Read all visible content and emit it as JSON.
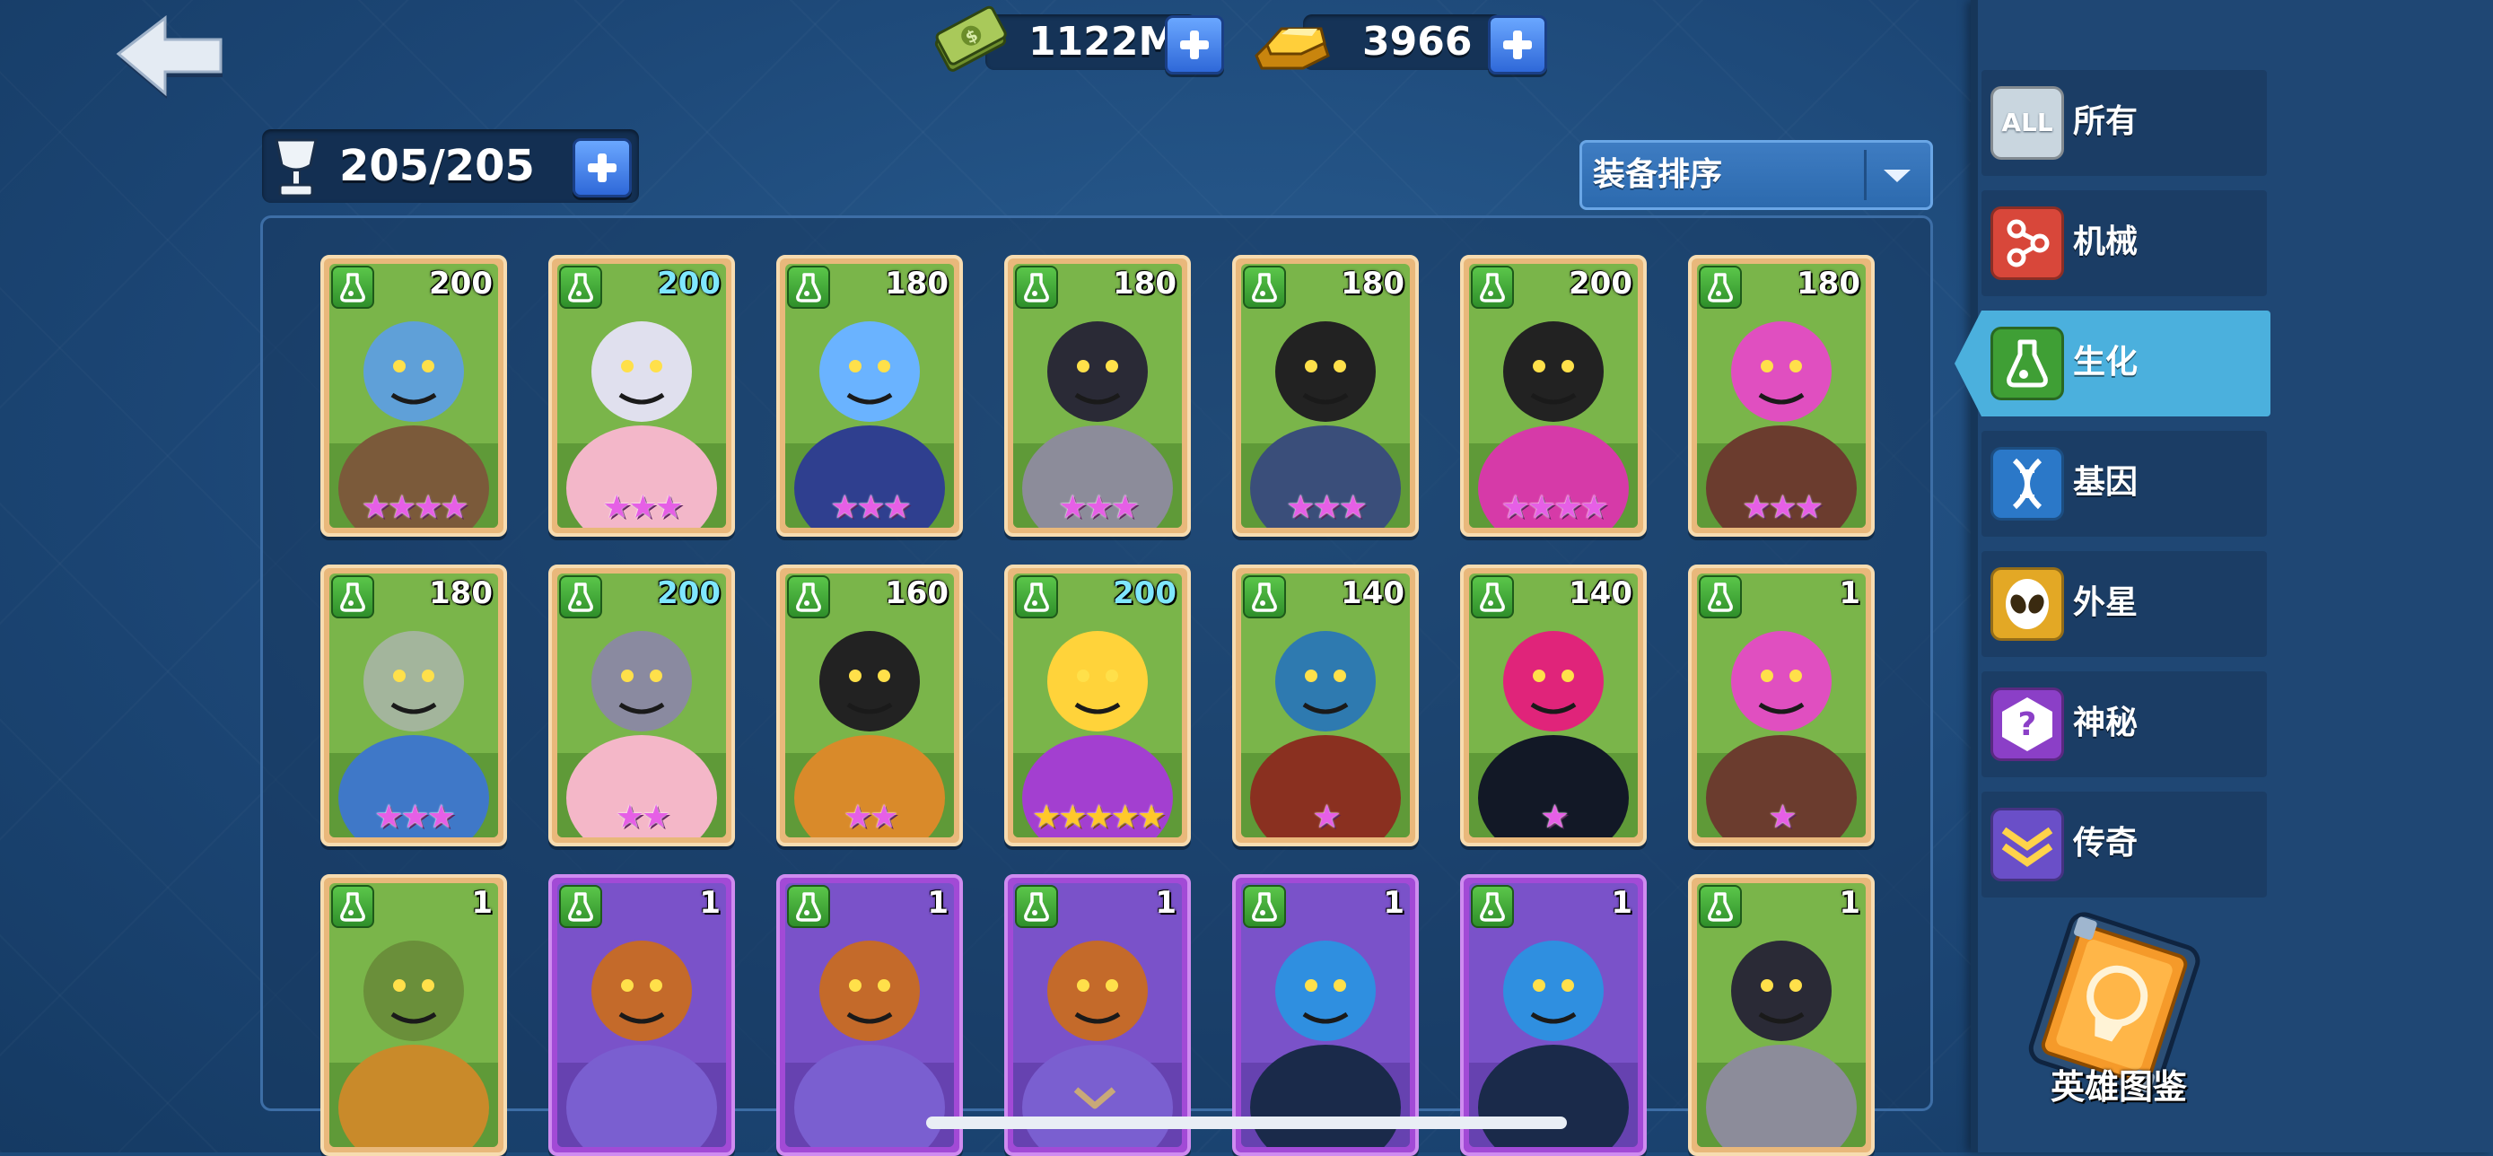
{
  "currency": {
    "cash": {
      "value": "1122M",
      "icon": "cash-icon"
    },
    "gold": {
      "value": "3966",
      "icon": "gold-bar-icon"
    }
  },
  "roster": {
    "count": "205/205",
    "icon": "trophy-cup-icon"
  },
  "sort": {
    "label": "装备排序"
  },
  "sidebar": {
    "items": [
      {
        "label": "所有",
        "icon": "all-icon",
        "icon_text": "ALL",
        "color": "#c9d6df",
        "active": false
      },
      {
        "label": "机械",
        "icon": "mechanical-icon",
        "color": "#d8473a",
        "active": false
      },
      {
        "label": "生化",
        "icon": "biochemical-flask-icon",
        "color": "#3f9f35",
        "active": true
      },
      {
        "label": "基因",
        "icon": "gene-dna-icon",
        "color": "#2b78c8",
        "active": false
      },
      {
        "label": "外星",
        "icon": "alien-icon",
        "color": "#e3a825",
        "active": false
      },
      {
        "label": "神秘",
        "icon": "mystic-question-icon",
        "color": "#8b3fc7",
        "active": false
      },
      {
        "label": "传奇",
        "icon": "legendary-chevron-icon",
        "color": "#6a4fc8",
        "active": false
      }
    ],
    "codex_label": "英雄图鉴"
  },
  "heroes": [
    {
      "level": "200",
      "stars": "★★★★",
      "frame": "orange",
      "level_color": "white",
      "star_color": "pink"
    },
    {
      "level": "200",
      "stars": "★★★",
      "frame": "orange",
      "level_color": "cyan",
      "star_color": "pink"
    },
    {
      "level": "180",
      "stars": "★★★",
      "frame": "orange",
      "level_color": "white",
      "star_color": "pink"
    },
    {
      "level": "180",
      "stars": "★★★",
      "frame": "orange",
      "level_color": "white",
      "star_color": "pink"
    },
    {
      "level": "180",
      "stars": "★★★",
      "frame": "orange",
      "level_color": "white",
      "star_color": "pink"
    },
    {
      "level": "200",
      "stars": "★★★★",
      "frame": "orange",
      "level_color": "white",
      "star_color": "pink"
    },
    {
      "level": "180",
      "stars": "★★★",
      "frame": "orange",
      "level_color": "white",
      "star_color": "pink"
    },
    {
      "level": "180",
      "stars": "★★★",
      "frame": "orange",
      "level_color": "white",
      "star_color": "pink"
    },
    {
      "level": "200",
      "stars": "★★",
      "frame": "orange",
      "level_color": "cyan",
      "star_color": "pink"
    },
    {
      "level": "160",
      "stars": "★★",
      "frame": "orange",
      "level_color": "white",
      "star_color": "pink"
    },
    {
      "level": "200",
      "stars": "★★★★★",
      "frame": "orange",
      "level_color": "cyan",
      "star_color": "gold"
    },
    {
      "level": "140",
      "stars": "★",
      "frame": "orange",
      "level_color": "white",
      "star_color": "pink"
    },
    {
      "level": "140",
      "stars": "★",
      "frame": "orange",
      "level_color": "white",
      "star_color": "pink"
    },
    {
      "level": "1",
      "stars": "★",
      "frame": "orange",
      "level_color": "white",
      "star_color": "pink"
    },
    {
      "level": "1",
      "stars": "",
      "frame": "orange",
      "level_color": "white",
      "star_color": "pink"
    },
    {
      "level": "1",
      "stars": "",
      "frame": "purple",
      "level_color": "white",
      "star_color": "pink"
    },
    {
      "level": "1",
      "stars": "",
      "frame": "purple",
      "level_color": "white",
      "star_color": "pink"
    },
    {
      "level": "1",
      "stars": "",
      "frame": "purple",
      "level_color": "white",
      "star_color": "pink"
    },
    {
      "level": "1",
      "stars": "",
      "frame": "purple",
      "level_color": "white",
      "star_color": "pink"
    },
    {
      "level": "1",
      "stars": "",
      "frame": "purple",
      "level_color": "white",
      "star_color": "pink"
    },
    {
      "level": "1",
      "stars": "",
      "frame": "orange",
      "level_color": "white",
      "star_color": "pink"
    }
  ]
}
